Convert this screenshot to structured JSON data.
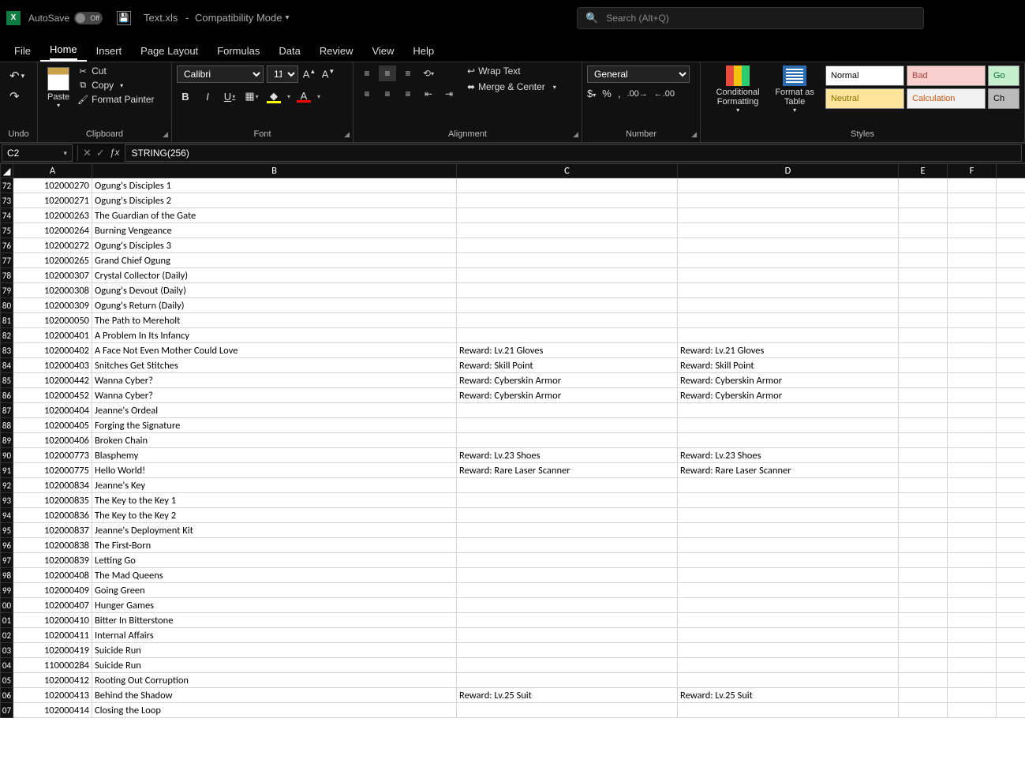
{
  "titlebar": {
    "autosave_label": "AutoSave",
    "autosave_state": "Off",
    "doc_name": "Text.xls",
    "compat": "Compatibility Mode",
    "search_placeholder": "Search (Alt+Q)"
  },
  "tabs": {
    "file": "File",
    "home": "Home",
    "insert": "Insert",
    "page_layout": "Page Layout",
    "formulas": "Formulas",
    "data": "Data",
    "review": "Review",
    "view": "View",
    "help": "Help"
  },
  "ribbon": {
    "undo_label": "Undo",
    "clipboard": {
      "paste": "Paste",
      "cut": "Cut",
      "copy": "Copy",
      "format_painter": "Format Painter",
      "label": "Clipboard"
    },
    "font": {
      "name": "Calibri",
      "size": "11",
      "label": "Font"
    },
    "alignment": {
      "wrap": "Wrap Text",
      "merge": "Merge & Center",
      "label": "Alignment"
    },
    "number": {
      "format": "General",
      "label": "Number"
    },
    "styles": {
      "conditional": "Conditional Formatting",
      "format_table": "Format as Table",
      "normal": "Normal",
      "bad": "Bad",
      "good": "Go",
      "neutral": "Neutral",
      "calculation": "Calculation",
      "check": "Ch",
      "label": "Styles"
    }
  },
  "formula_bar": {
    "name_box": "C2",
    "formula": "STRING(256)"
  },
  "columns": [
    "A",
    "B",
    "C",
    "D",
    "E",
    "F"
  ],
  "rows": [
    {
      "n": "72",
      "a": "102000270",
      "b": "Ogung's Disciples 1",
      "c": "",
      "d": ""
    },
    {
      "n": "73",
      "a": "102000271",
      "b": "Ogung's Disciples 2",
      "c": "",
      "d": ""
    },
    {
      "n": "74",
      "a": "102000263",
      "b": "The Guardian of the Gate",
      "c": "",
      "d": ""
    },
    {
      "n": "75",
      "a": "102000264",
      "b": "Burning Vengeance",
      "c": "",
      "d": ""
    },
    {
      "n": "76",
      "a": "102000272",
      "b": "Ogung's Disciples 3",
      "c": "",
      "d": ""
    },
    {
      "n": "77",
      "a": "102000265",
      "b": "Grand Chief Ogung",
      "c": "",
      "d": ""
    },
    {
      "n": "78",
      "a": "102000307",
      "b": "Crystal Collector (Daily)",
      "c": "",
      "d": ""
    },
    {
      "n": "79",
      "a": "102000308",
      "b": "Ogung's Devout (Daily)",
      "c": "",
      "d": ""
    },
    {
      "n": "80",
      "a": "102000309",
      "b": "Ogung's Return (Daily)",
      "c": "",
      "d": ""
    },
    {
      "n": "81",
      "a": "102000050",
      "b": "The Path to Mereholt",
      "c": "",
      "d": ""
    },
    {
      "n": "82",
      "a": "102000401",
      "b": "A Problem In Its Infancy",
      "c": "",
      "d": ""
    },
    {
      "n": "83",
      "a": "102000402",
      "b": "A Face Not Even Mother Could Love",
      "c": "Reward: Lv.21 Gloves",
      "d": "Reward: Lv.21 Gloves"
    },
    {
      "n": "84",
      "a": "102000403",
      "b": "Snitches Get Stitches",
      "c": "Reward: Skill Point",
      "d": "Reward: Skill Point"
    },
    {
      "n": "85",
      "a": "102000442",
      "b": "Wanna Cyber?",
      "c": "Reward: Cyberskin Armor",
      "d": "Reward: Cyberskin Armor"
    },
    {
      "n": "86",
      "a": "102000452",
      "b": "Wanna Cyber?",
      "c": "Reward: Cyberskin Armor",
      "d": "Reward: Cyberskin Armor"
    },
    {
      "n": "87",
      "a": "102000404",
      "b": "Jeanne's Ordeal",
      "c": "",
      "d": ""
    },
    {
      "n": "88",
      "a": "102000405",
      "b": "Forging the Signature",
      "c": "",
      "d": ""
    },
    {
      "n": "89",
      "a": "102000406",
      "b": "Broken Chain",
      "c": "",
      "d": ""
    },
    {
      "n": "90",
      "a": "102000773",
      "b": "Blasphemy",
      "c": "Reward: Lv.23 Shoes",
      "d": "Reward: Lv.23 Shoes"
    },
    {
      "n": "91",
      "a": "102000775",
      "b": "Hello World!",
      "c": "Reward: Rare Laser Scanner",
      "d": "Reward: Rare Laser Scanner"
    },
    {
      "n": "92",
      "a": "102000834",
      "b": "Jeanne's Key",
      "c": "",
      "d": ""
    },
    {
      "n": "93",
      "a": "102000835",
      "b": "The Key to the Key 1",
      "c": "",
      "d": ""
    },
    {
      "n": "94",
      "a": "102000836",
      "b": "The Key to the Key 2",
      "c": "",
      "d": ""
    },
    {
      "n": "95",
      "a": "102000837",
      "b": "Jeanne's Deployment Kit",
      "c": "",
      "d": ""
    },
    {
      "n": "96",
      "a": "102000838",
      "b": "The First-Born",
      "c": "",
      "d": ""
    },
    {
      "n": "97",
      "a": "102000839",
      "b": "Letting Go",
      "c": "",
      "d": ""
    },
    {
      "n": "98",
      "a": "102000408",
      "b": "The Mad Queens",
      "c": "",
      "d": ""
    },
    {
      "n": "99",
      "a": "102000409",
      "b": "Going Green",
      "c": "",
      "d": ""
    },
    {
      "n": "00",
      "a": "102000407",
      "b": "Hunger Games",
      "c": "",
      "d": ""
    },
    {
      "n": "01",
      "a": "102000410",
      "b": "Bitter In Bitterstone",
      "c": "",
      "d": ""
    },
    {
      "n": "02",
      "a": "102000411",
      "b": "Internal Affairs",
      "c": "",
      "d": ""
    },
    {
      "n": "03",
      "a": "102000419",
      "b": "Suicide Run",
      "c": "",
      "d": ""
    },
    {
      "n": "04",
      "a": "110000284",
      "b": "Suicide Run",
      "c": "",
      "d": ""
    },
    {
      "n": "05",
      "a": "102000412",
      "b": "Rooting Out Corruption",
      "c": "",
      "d": ""
    },
    {
      "n": "06",
      "a": "102000413",
      "b": "Behind the Shadow",
      "c": "Reward: Lv.25 Suit",
      "d": "Reward: Lv.25 Suit"
    },
    {
      "n": "07",
      "a": "102000414",
      "b": "Closing the Loop",
      "c": "",
      "d": ""
    }
  ]
}
